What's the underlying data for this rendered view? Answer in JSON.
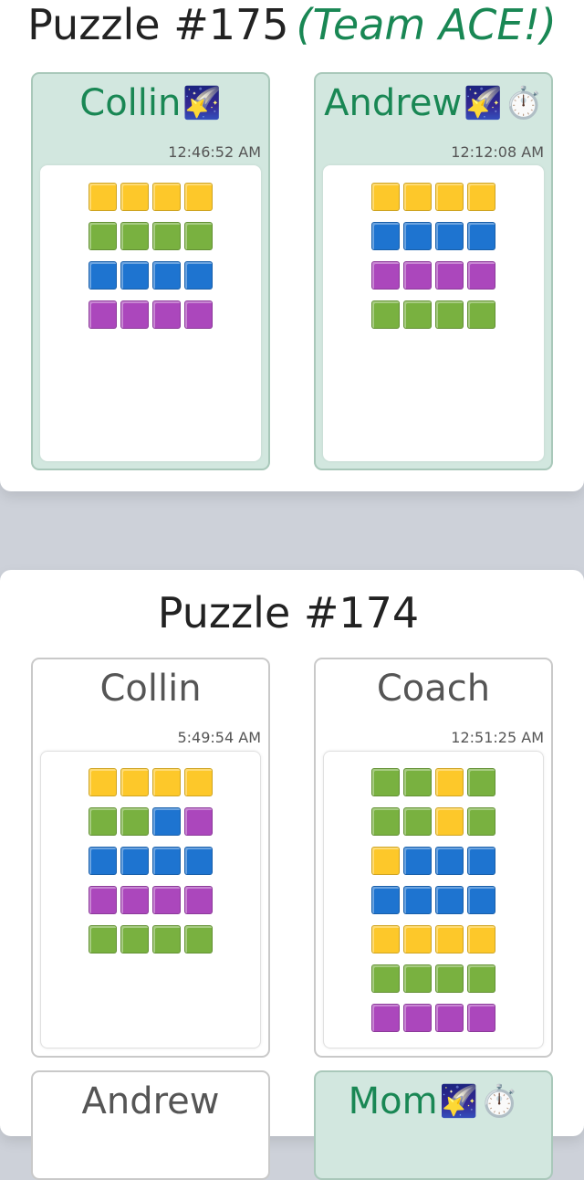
{
  "colors": {
    "yellow": "#fdc82a",
    "green": "#79b140",
    "blue": "#1e74d0",
    "purple": "#ab47bc",
    "solved_accent": "#198754"
  },
  "puzzles": [
    {
      "title": "Puzzle #175",
      "team_tag": "(Team ACE!)",
      "cards": [
        {
          "name": "Collin",
          "badges": [
            "🌠"
          ],
          "badge_icons": [
            "shooting-star-icon"
          ],
          "time": "12:46:52 AM",
          "solved": true,
          "grid": [
            [
              "yellow",
              "yellow",
              "yellow",
              "yellow"
            ],
            [
              "green",
              "green",
              "green",
              "green"
            ],
            [
              "blue",
              "blue",
              "blue",
              "blue"
            ],
            [
              "purple",
              "purple",
              "purple",
              "purple"
            ]
          ]
        },
        {
          "name": "Andrew",
          "badges": [
            "🌠",
            "⏱️"
          ],
          "badge_icons": [
            "shooting-star-icon",
            "stopwatch-icon"
          ],
          "time": "12:12:08 AM",
          "solved": true,
          "grid": [
            [
              "yellow",
              "yellow",
              "yellow",
              "yellow"
            ],
            [
              "blue",
              "blue",
              "blue",
              "blue"
            ],
            [
              "purple",
              "purple",
              "purple",
              "purple"
            ],
            [
              "green",
              "green",
              "green",
              "green"
            ]
          ]
        }
      ]
    },
    {
      "title": "Puzzle #174",
      "team_tag": "",
      "cards": [
        {
          "name": "Collin",
          "badges": [],
          "badge_icons": [],
          "time": "5:49:54 AM",
          "solved": false,
          "grid": [
            [
              "yellow",
              "yellow",
              "yellow",
              "yellow"
            ],
            [
              "green",
              "green",
              "blue",
              "purple"
            ],
            [
              "blue",
              "blue",
              "blue",
              "blue"
            ],
            [
              "purple",
              "purple",
              "purple",
              "purple"
            ],
            [
              "green",
              "green",
              "green",
              "green"
            ]
          ]
        },
        {
          "name": "Coach",
          "badges": [],
          "badge_icons": [],
          "time": "12:51:25 AM",
          "solved": false,
          "grid": [
            [
              "green",
              "green",
              "yellow",
              "green"
            ],
            [
              "green",
              "green",
              "yellow",
              "green"
            ],
            [
              "yellow",
              "blue",
              "blue",
              "blue"
            ],
            [
              "blue",
              "blue",
              "blue",
              "blue"
            ],
            [
              "yellow",
              "yellow",
              "yellow",
              "yellow"
            ],
            [
              "green",
              "green",
              "green",
              "green"
            ],
            [
              "purple",
              "purple",
              "purple",
              "purple"
            ]
          ]
        },
        {
          "name": "Andrew",
          "badges": [],
          "badge_icons": [],
          "time": "",
          "solved": false,
          "grid": []
        },
        {
          "name": "Mom",
          "badges": [
            "🌠",
            "⏱️"
          ],
          "badge_icons": [
            "shooting-star-icon",
            "stopwatch-icon"
          ],
          "time": "",
          "solved": true,
          "grid": []
        }
      ]
    }
  ]
}
